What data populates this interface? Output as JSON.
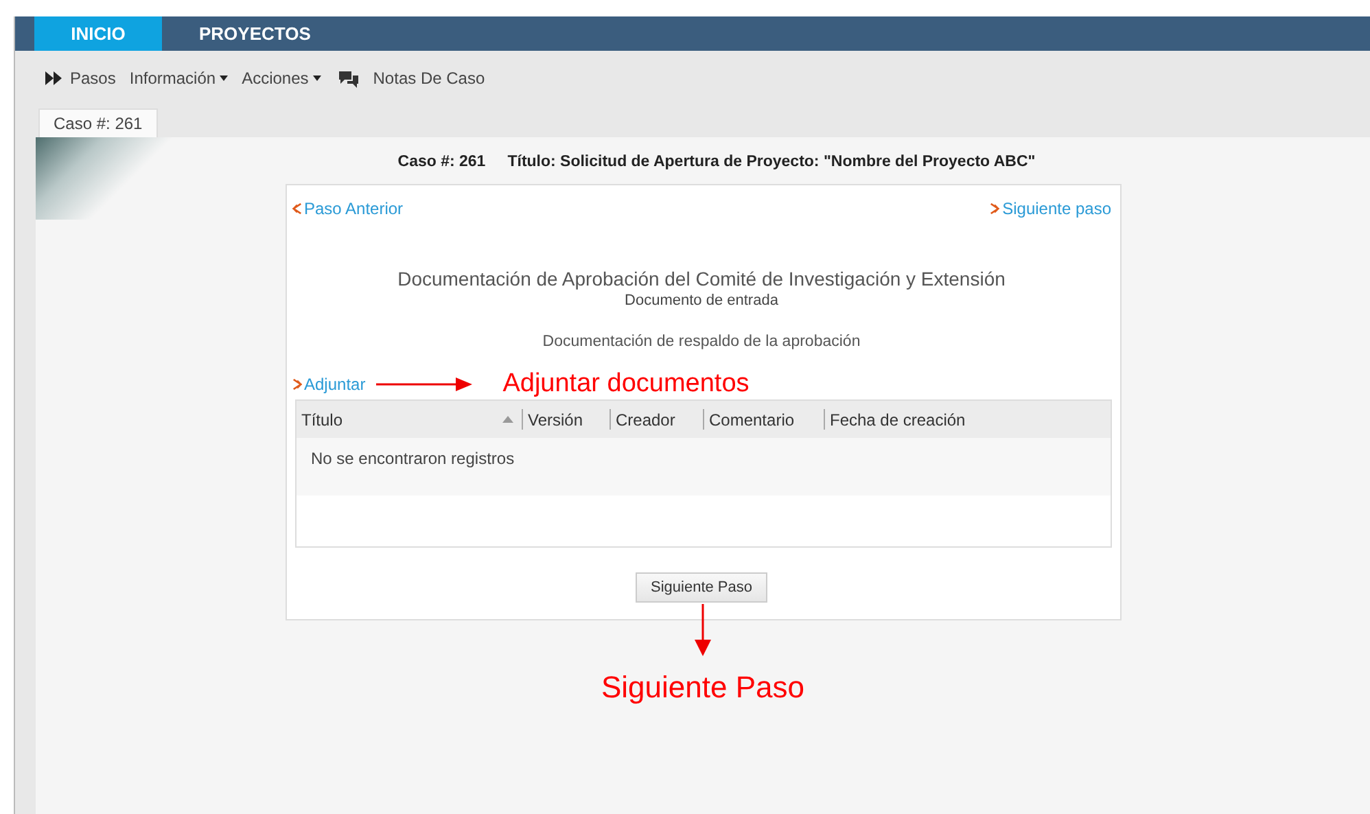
{
  "nav_tabs": [
    {
      "label": "INICIO",
      "selected": true
    },
    {
      "label": "PROYECTOS",
      "selected": false
    }
  ],
  "toolbar": [
    {
      "label": "Pasos",
      "kind": "steps"
    },
    {
      "label": "Información",
      "kind": "dropdown"
    },
    {
      "label": "Acciones",
      "kind": "dropdown"
    },
    {
      "label": "Notas De Caso",
      "kind": "notes"
    }
  ],
  "case_tab": "Caso #: 261",
  "case_header": {
    "case_number": "Caso #: 261",
    "title": "Título: Solicitud de Apertura de Proyecto: \"Nombre del Proyecto ABC\""
  },
  "step": {
    "prev_link": "Paso Anterior",
    "next_link": "Siguiente paso",
    "heading": "Documentación de Aprobación del Comité de Investigación y Extensión",
    "subheading": "Documento de entrada",
    "description": "Documentación de respaldo de la aprobación",
    "attach_link": "Adjuntar",
    "table": {
      "columns": [
        {
          "label": "Título",
          "sorted": true
        },
        {
          "label": "Versión",
          "sorted": false
        },
        {
          "label": "Creador",
          "sorted": false
        },
        {
          "label": "Comentario",
          "sorted": false
        },
        {
          "label": "Fecha de creación",
          "sorted": false
        }
      ],
      "empty_message": "No se encontraron registros"
    },
    "button": "Siguiente Paso"
  },
  "annotations": {
    "attach": "Adjuntar documentos",
    "next": "Siguiente Paso"
  }
}
